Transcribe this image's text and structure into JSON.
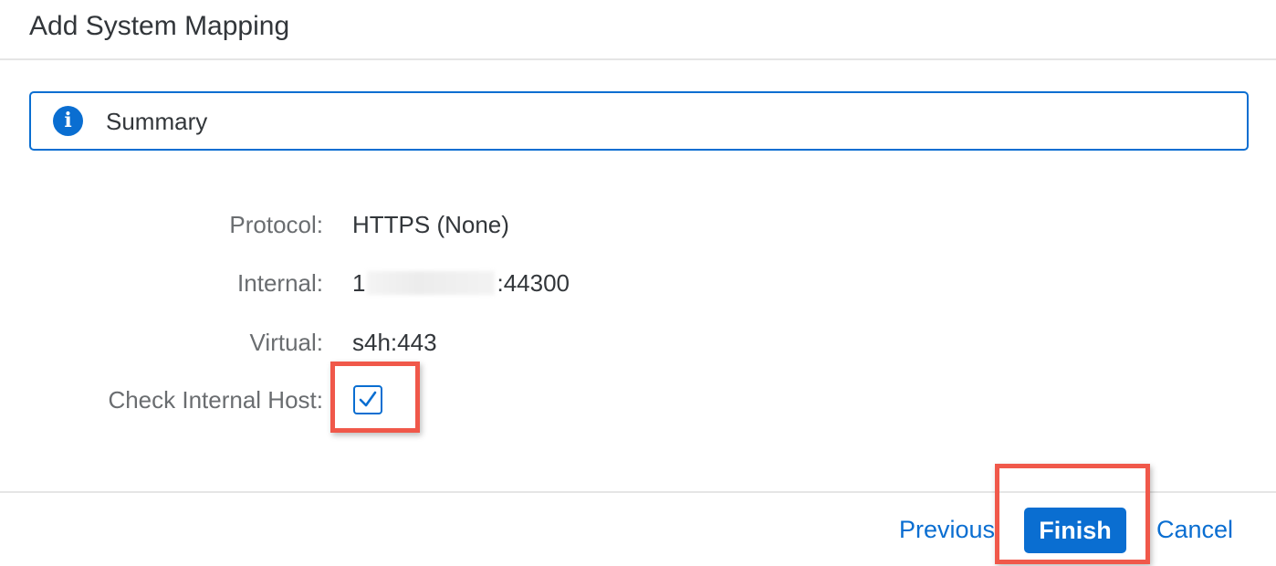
{
  "dialog": {
    "title": "Add System Mapping"
  },
  "info_strip": {
    "icon": "info-icon",
    "icon_glyph": "i",
    "text": "Summary",
    "color": "#0a6ed1"
  },
  "form": {
    "protocol_label": "Protocol:",
    "protocol_value": "HTTPS (None)",
    "internal_label": "Internal:",
    "internal_value_prefix": "1",
    "internal_value_suffix": ":44300",
    "virtual_label": "Virtual:",
    "virtual_value": "s4h:443",
    "check_host_label": "Check Internal Host:",
    "check_host_checked": true
  },
  "footer": {
    "previous_label": "Previous",
    "finish_label": "Finish",
    "cancel_label": "Cancel"
  },
  "colors": {
    "accent": "#0a6ed1",
    "highlight": "#f0584a",
    "text": "#32363a",
    "label": "#6a6d70"
  }
}
